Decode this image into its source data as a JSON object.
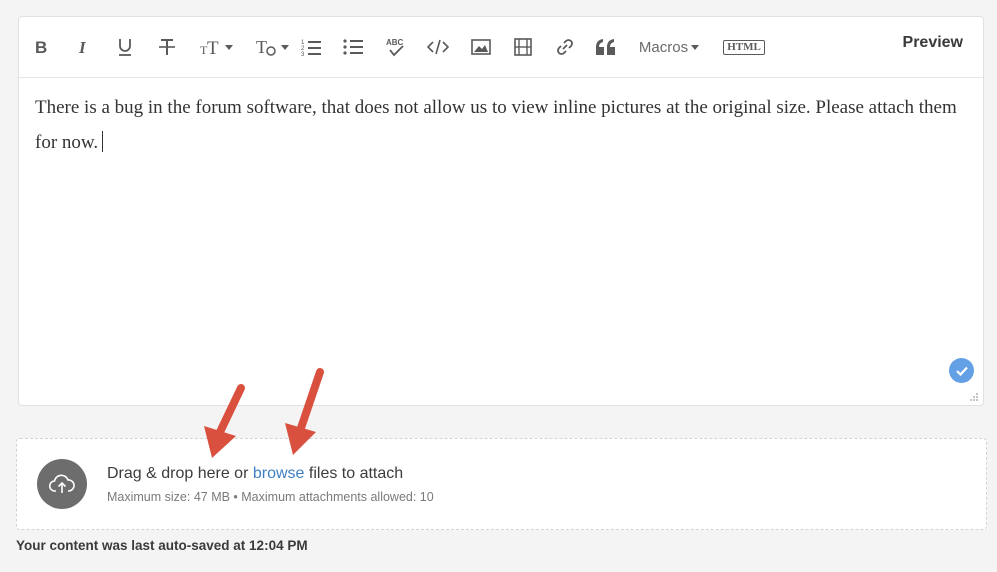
{
  "toolbar": {
    "items": [
      {
        "name": "bold-icon"
      },
      {
        "name": "italic-icon"
      },
      {
        "name": "underline-icon"
      },
      {
        "name": "strikethrough-icon"
      },
      {
        "name": "font-size-icon"
      },
      {
        "name": "text-style-icon"
      },
      {
        "name": "numbered-list-icon"
      },
      {
        "name": "bullet-list-icon"
      },
      {
        "name": "spellcheck-icon"
      },
      {
        "name": "code-icon"
      },
      {
        "name": "image-icon"
      },
      {
        "name": "video-icon"
      },
      {
        "name": "link-icon"
      },
      {
        "name": "quote-icon"
      }
    ],
    "macros_label": "Macros",
    "html_label": "HTML",
    "preview_label": "Preview"
  },
  "editor": {
    "content": "There is a bug in the forum software, that does not allow us to view inline pictures at the original size. Please attach them for now."
  },
  "dropzone": {
    "prefix": "Drag & drop here or ",
    "browse_label": "browse",
    "suffix": " files to attach",
    "limits": "Maximum size: 47 MB • Maximum attachments allowed: 10"
  },
  "status": {
    "autosave": "Your content was last auto-saved at 12:04 PM"
  },
  "colors": {
    "link": "#3f7fc2",
    "check_badge": "#4a90e2",
    "annotation_arrow": "#d9503f"
  }
}
